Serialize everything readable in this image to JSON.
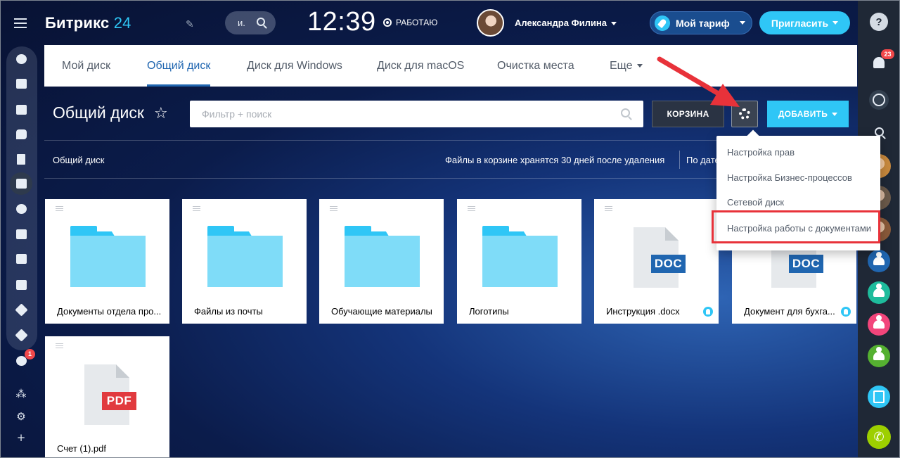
{
  "header": {
    "logo_main": "Битрикс",
    "logo_num": "24",
    "search_label": "и.",
    "time": "12:39",
    "work_status": "РАБОТАЮ",
    "user_name": "Александра Филина",
    "tariff_label": "Мой тариф",
    "invite_label": "Пригласить"
  },
  "tabs": [
    {
      "label": "Мой диск",
      "active": false
    },
    {
      "label": "Общий диск",
      "active": true
    },
    {
      "label": "Диск для Windows",
      "active": false
    },
    {
      "label": "Диск для macOS",
      "active": false
    },
    {
      "label": "Очистка места",
      "active": false
    },
    {
      "label": "Еще",
      "active": false
    }
  ],
  "toolbar": {
    "page_title": "Общий диск",
    "filter_placeholder": "Фильтр + поиск",
    "trash_label": "КОРЗИНА",
    "add_label": "ДОБАВИТЬ"
  },
  "info_bar": {
    "breadcrumb": "Общий диск",
    "trash_note": "Файлы в корзине хранятся 30 дней после удаления",
    "sort_label": "По дате"
  },
  "files": [
    {
      "name": "Документы отдела про...",
      "type": "folder",
      "shared": false
    },
    {
      "name": "Файлы из почты",
      "type": "folder",
      "shared": false
    },
    {
      "name": "Обучающие материалы",
      "type": "folder",
      "shared": false
    },
    {
      "name": "Логотипы",
      "type": "folder",
      "shared": false
    },
    {
      "name": "Инструкция .docx",
      "type": "doc",
      "badge": "DOC",
      "shared": true
    },
    {
      "name": "Документ для бухга...",
      "type": "doc",
      "badge": "DOC",
      "shared": true
    },
    {
      "name": "Счет (1).pdf",
      "type": "pdf",
      "badge": "PDF",
      "shared": false
    }
  ],
  "settings_menu": {
    "items": [
      "Настройка прав",
      "Настройка Бизнес-процессов",
      "Сетевой диск",
      "Настройка работы с документами"
    ],
    "highlighted_index": 3
  },
  "left_nav": {
    "badge": "1"
  },
  "right_rail": {
    "notifications_count": "23"
  },
  "colors": {
    "accent": "#2fc6f6",
    "active_tab": "#2066b0",
    "doc_badge": "#2066b0",
    "pdf_badge": "#e13a3e",
    "annotation": "#e8323a"
  }
}
